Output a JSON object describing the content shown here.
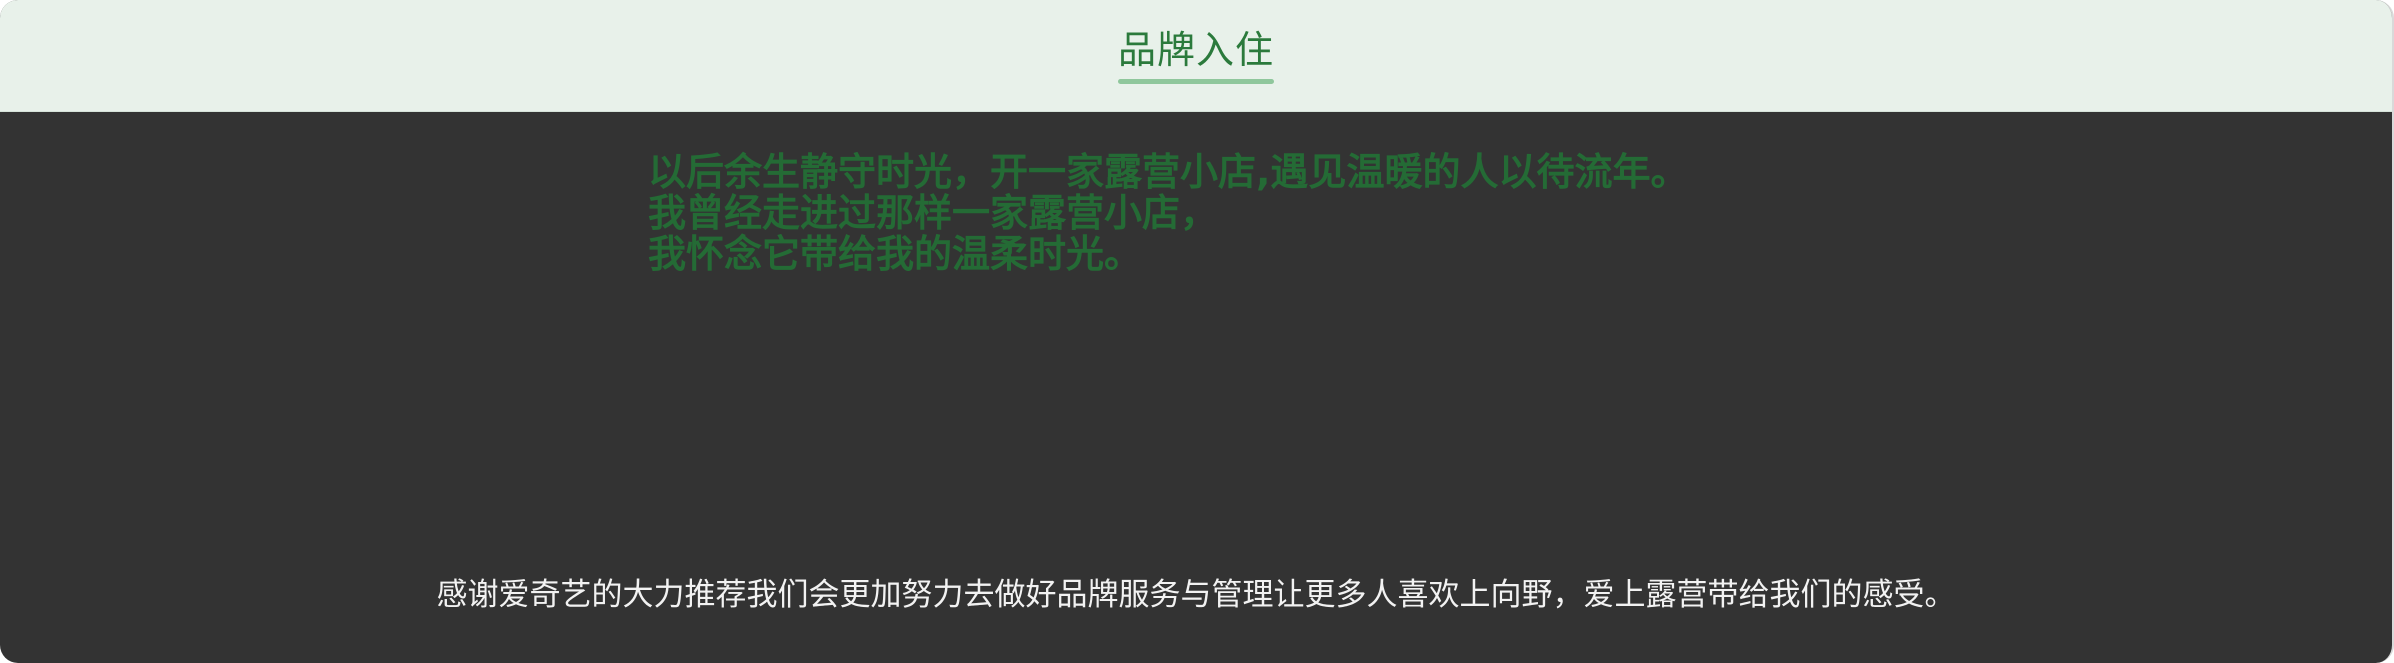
{
  "header": {
    "tab_label": "品牌入住"
  },
  "story": {
    "lines": [
      "以后余生静守时光，开一家露营小店,遇见温暖的人以待流年。",
      "我曾经走进过那样一家露营小店，",
      "我怀念它带给我的温柔时光。"
    ]
  },
  "footer": {
    "thanks_text": "感谢爱奇艺的大力推荐我们会更加努力去做好品牌服务与管理让更多人喜欢上向野，爱上露营带给我们的感受。"
  },
  "colors": {
    "header_bg": "#e8f1ea",
    "accent_green": "#2b7a3c",
    "underline_green": "#8fc79c",
    "panel_bg": "#333333",
    "story_text": "#246b35",
    "footer_text": "#f2f2f2"
  }
}
